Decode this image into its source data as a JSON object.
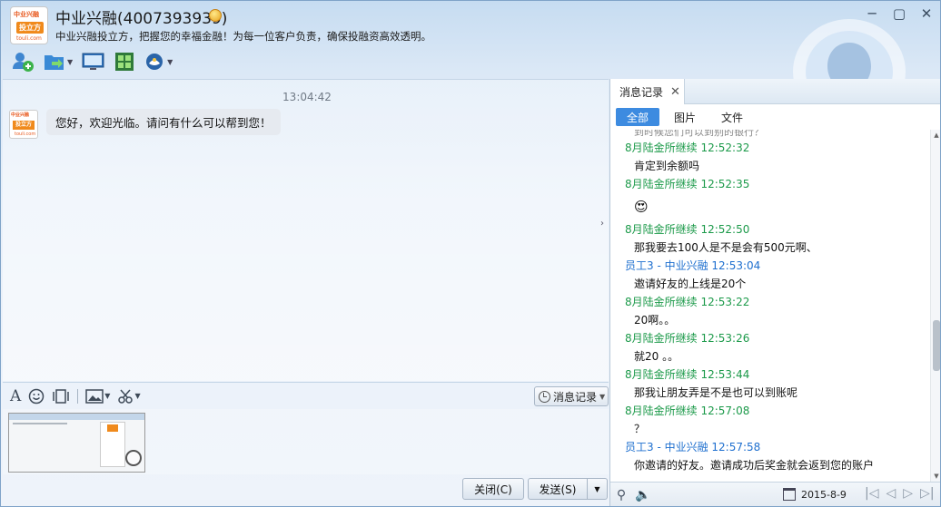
{
  "window": {
    "title": "中业兴融(4007393939)",
    "subtitle": "中业兴融投立方，把握您的幸福金融！为每一位客户负责，确保投融资高效透明。",
    "logo": {
      "line1": "中业兴融",
      "line2": "投立方",
      "line3": "touli.com"
    },
    "controls": [
      "─",
      "▢",
      "✕"
    ]
  },
  "toolbar": {
    "icons": [
      "add-contact-icon",
      "send-file-icon",
      "remote-desktop-icon",
      "app-grid-icon",
      "status-icon"
    ]
  },
  "chat": {
    "timestamp": "13:04:42",
    "messages": [
      {
        "text": "您好，欢迎光临。请问有什么可以帮到您！"
      }
    ]
  },
  "input_toolbar": {
    "font_icon": "A",
    "history_button": "消息记录"
  },
  "buttons": {
    "close": "关闭(C)",
    "send": "发送(S)"
  },
  "history": {
    "tab_label": "消息记录",
    "filters": [
      "全部",
      "图片",
      "文件"
    ],
    "active_filter": "全部",
    "entries": [
      {
        "type": "partial",
        "text": "到时候您们可以到别的银行？"
      },
      {
        "type": "name",
        "role": "customer",
        "text": "8月陆金所继续 12:52:32"
      },
      {
        "type": "text",
        "text": "肯定到余额吗"
      },
      {
        "type": "name",
        "role": "customer",
        "text": "8月陆金所继续 12:52:35"
      },
      {
        "type": "emoji",
        "text": "😍"
      },
      {
        "type": "name",
        "role": "customer",
        "text": "8月陆金所继续 12:52:50"
      },
      {
        "type": "text",
        "text": "那我要去100人是不是会有500元啊、"
      },
      {
        "type": "name",
        "role": "staff",
        "text": "员工3 - 中业兴融 12:53:04"
      },
      {
        "type": "text",
        "text": "邀请好友的上线是20个"
      },
      {
        "type": "name",
        "role": "customer",
        "text": "8月陆金所继续 12:53:22"
      },
      {
        "type": "text",
        "text": "20啊。。"
      },
      {
        "type": "name",
        "role": "customer",
        "text": "8月陆金所继续 12:53:26"
      },
      {
        "type": "text",
        "text": "就20 。。"
      },
      {
        "type": "name",
        "role": "customer",
        "text": "8月陆金所继续 12:53:44"
      },
      {
        "type": "text",
        "text": "那我让朋友弄是不是也可以到账呢"
      },
      {
        "type": "name",
        "role": "customer",
        "text": "8月陆金所继续 12:57:08"
      },
      {
        "type": "text",
        "text": "？"
      },
      {
        "type": "name",
        "role": "staff",
        "text": "员工3 - 中业兴融 12:57:58"
      },
      {
        "type": "text",
        "text": "你邀请的好友。邀请成功后奖金就会返到您的账户"
      }
    ],
    "date": "2015-8-9"
  },
  "colors": {
    "customer_name": "#1c9a4a",
    "staff_name": "#1e6fcf",
    "active_filter": "#3d8be0"
  }
}
